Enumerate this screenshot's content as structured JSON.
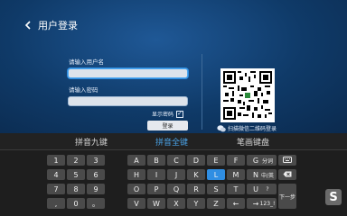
{
  "header": {
    "title": "用户登录",
    "back_icon": "chevron-left-icon"
  },
  "form": {
    "username_label": "请输入用户名",
    "username_value": "",
    "password_label": "请输入密码",
    "password_value": "",
    "show_password_label": "显示密码",
    "show_password_checked": true,
    "checkbox_mark": "✓",
    "login_label": "登录"
  },
  "qr": {
    "caption": "扫描微信二维码登录",
    "wechat_icon": "wechat-icon"
  },
  "keyboard": {
    "tabs": [
      "拼音九键",
      "拼音全键",
      "笔画键盘"
    ],
    "active_tab": 1,
    "numpad": [
      "1",
      "2",
      "3",
      "4",
      "5",
      "6",
      "7",
      "8",
      "9",
      ",",
      "0",
      "。"
    ],
    "letters_row1": [
      "A",
      "B",
      "C",
      "D",
      "E",
      "F",
      "G"
    ],
    "letters_row2": [
      "H",
      "I",
      "J",
      "K",
      "L",
      "M",
      "N"
    ],
    "letters_row3": [
      "O",
      "P",
      "Q",
      "R",
      "S",
      "T",
      "U"
    ],
    "letters_row4": [
      "V",
      "W",
      "X",
      "Y",
      "Z",
      "←",
      "→"
    ],
    "selected_key": "L",
    "func_col1": [
      "分词",
      "中/英",
      "?",
      "123_!"
    ],
    "func_col2_backspace_icon": "backspace-icon",
    "func_col2_next": "下一步",
    "logo_text": "S"
  },
  "colors": {
    "accent": "#4aa3e8",
    "selected_key": "#2f8ee3",
    "background": "#0f3a68",
    "keyboard_bg": "#1e1e1e"
  }
}
